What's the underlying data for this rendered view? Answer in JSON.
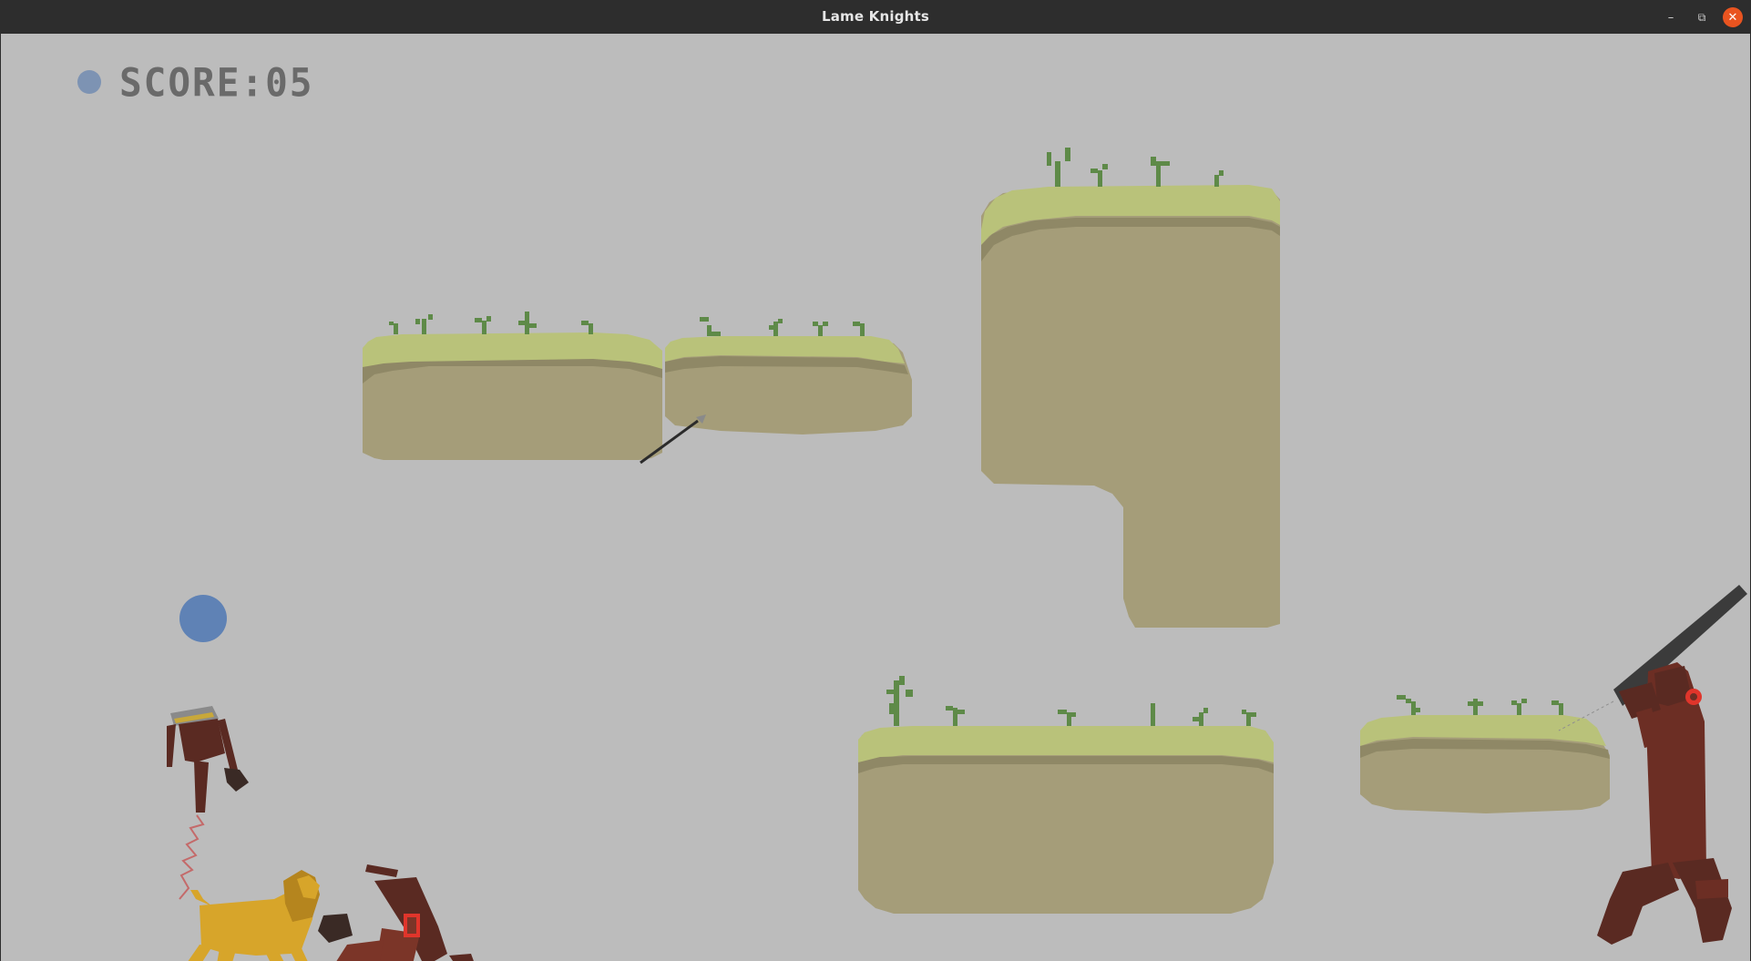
{
  "window": {
    "title": "Lame Knights",
    "controls": {
      "minimize_icon": "–",
      "maximize_icon": "⧉",
      "close_icon": "✕"
    }
  },
  "hud": {
    "score_text": "SCORE:05",
    "score_value": 5,
    "indicator_color": "#7d93b3"
  },
  "scene": {
    "background_color": "#bcbcbc",
    "colors": {
      "grass_top": "#b9c27a",
      "grass_mid": "#a9b468",
      "grass_dark": "#9aa45d",
      "dirt": "#a59d79",
      "dirt_shadow": "#8f8866",
      "sprout": "#5e8a48",
      "ball": "#5f82b5",
      "lion": "#d7a52a",
      "knight_dark": "#5a2a22",
      "knight_red": "#7b3528",
      "giant": "#6c2e24",
      "giant_eye": "#e0352b",
      "club": "#3b3b3b"
    },
    "entities": [
      "floating-platform",
      "floating-platform",
      "tall-cliff-platform",
      "wide-platform",
      "small-platform",
      "spear",
      "blue-ball",
      "headless-knight",
      "lion",
      "fallen-knight",
      "bow",
      "red-eyed-giant"
    ]
  }
}
